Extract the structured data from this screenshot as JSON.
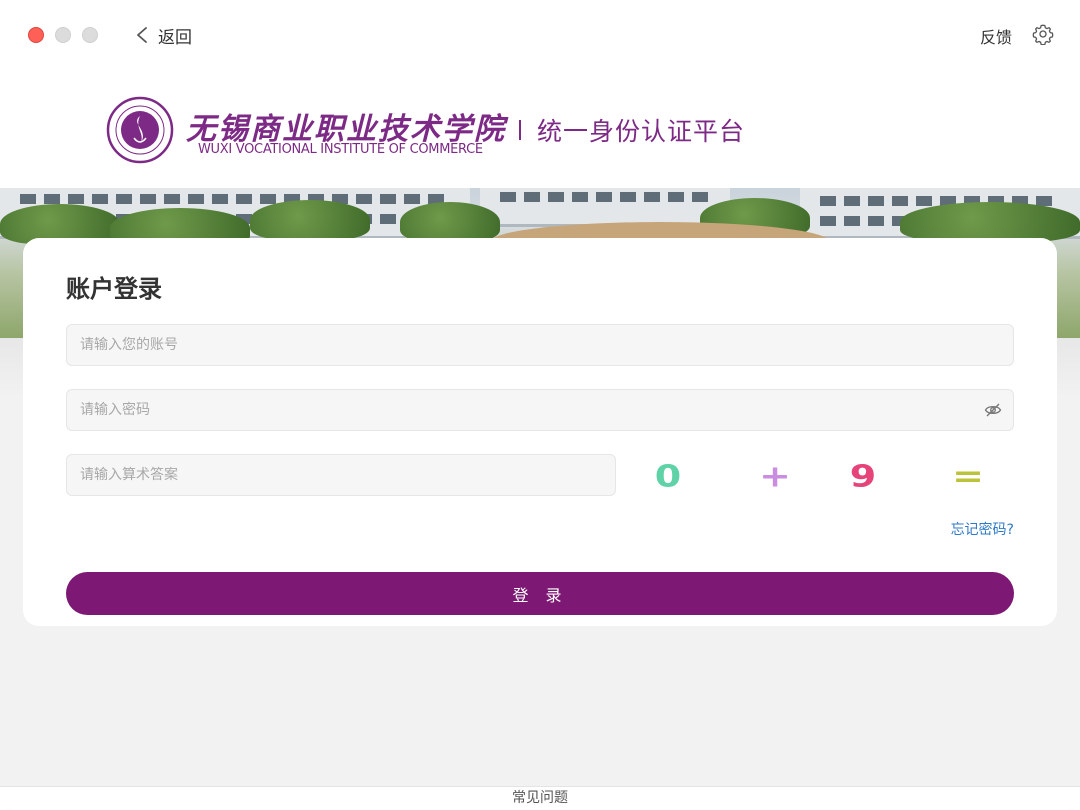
{
  "titlebar": {
    "back_label": "返回",
    "feedback_label": "反馈",
    "settings_icon": "gear-icon"
  },
  "header": {
    "school_name_cn": "无锡商业职业技术学院",
    "school_name_en": "WUXI VOCATIONAL INSTITUTE OF COMMERCE",
    "platform_name": "统一身份认证平台",
    "brand_color": "#7d2a86"
  },
  "login": {
    "title": "账户登录",
    "account_placeholder": "请输入您的账号",
    "account_value": "",
    "password_placeholder": "请输入密码",
    "password_value": "",
    "captcha_placeholder": "请输入算术答案",
    "captcha_value": "",
    "captcha": {
      "tokens": [
        "0",
        "+",
        "9",
        "="
      ],
      "colors": [
        "#5fd3a7",
        "#c98ee0",
        "#e5437a",
        "#bcc23a"
      ]
    },
    "forgot_label": "忘记密码?",
    "submit_label": "登 录",
    "submit_color": "#7e1875",
    "link_color": "#2f79c9"
  },
  "footer": {
    "faq_label": "常见问题"
  }
}
